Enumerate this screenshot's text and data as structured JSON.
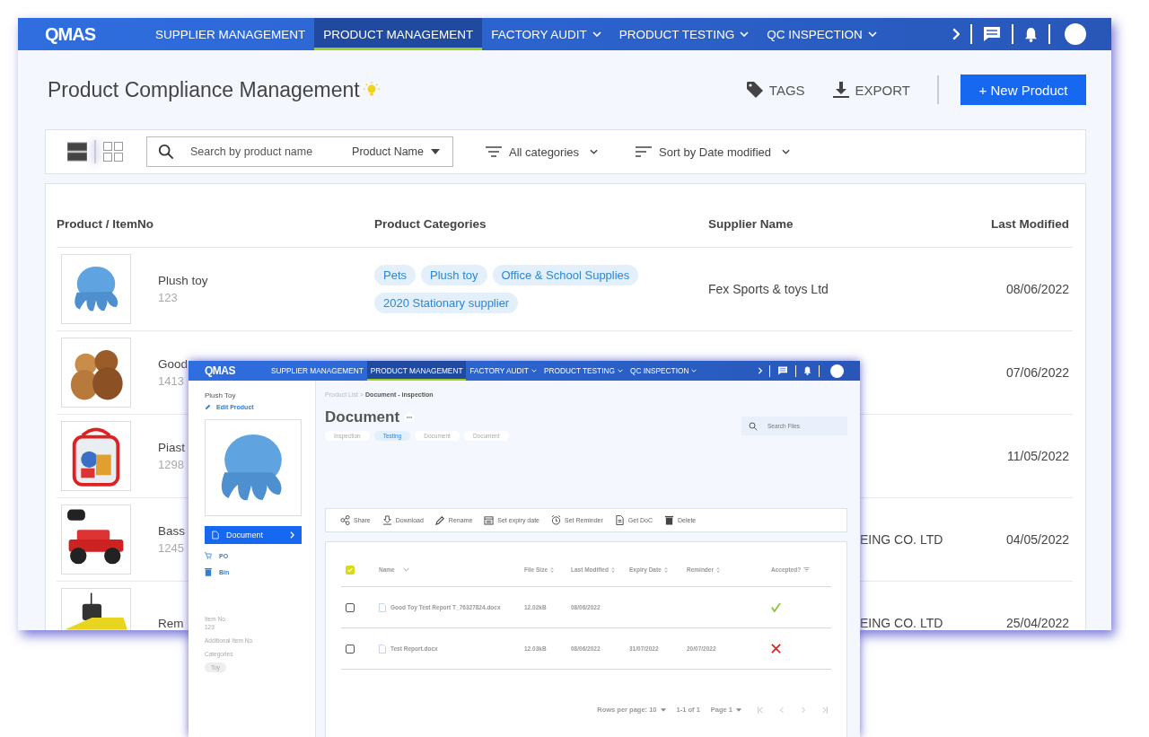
{
  "main_window": {
    "nav": {
      "logo": "QMAS",
      "items": [
        {
          "label": "SUPPLIER MANAGEMENT",
          "selected": false,
          "dropdown": false
        },
        {
          "label": "PRODUCT MANAGEMENT",
          "selected": true,
          "dropdown": false
        },
        {
          "label": "FACTORY AUDIT",
          "selected": false,
          "dropdown": true
        },
        {
          "label": "PRODUCT TESTING",
          "selected": false,
          "dropdown": true
        },
        {
          "label": "QC INSPECTION",
          "selected": false,
          "dropdown": true
        }
      ]
    },
    "title": "Product Compliance Management",
    "actions": [
      {
        "label": "TAGS",
        "kind": "tags"
      },
      {
        "label": "EXPORT",
        "kind": "export"
      }
    ],
    "new_button": "+ New Product",
    "view_modes": [
      {
        "kind": "list",
        "selected": true
      },
      {
        "kind": "grid",
        "selected": false
      }
    ],
    "toolbar": {
      "search_placeholder": "Search by product name",
      "search_field": "Product Name",
      "category_filter": "All categories",
      "sort": "Sort by Date modified"
    },
    "table": {
      "columns": [
        "Product / ItemNo",
        "Product Categories",
        "Supplier Name",
        "Last Modified"
      ],
      "rows": [
        {
          "name": "Plush toy",
          "item_no": "123",
          "categories": [
            "Pets",
            "Plush toy",
            "Office & School Supplies",
            "2020 Stationary supplier"
          ],
          "supplier": "Fex Sports & toys Ltd",
          "modified": "08/06/2022"
        },
        {
          "name": "Good",
          "item_no": "1413",
          "categories": [],
          "modified": "07/06/2022"
        },
        {
          "name": "Piast",
          "item_no": "1298",
          "categories": [],
          "modified": "11/05/2022"
        },
        {
          "name": "Bass",
          "item_no": "1245",
          "categories": [],
          "supplier": "EING CO. LTD",
          "modified": "04/05/2022"
        },
        {
          "name": "Rem",
          "categories": [],
          "supplier": "EING CO. LTD",
          "modified": "25/04/2022"
        }
      ]
    }
  },
  "detail_window": {
    "nav": {
      "logo": "QMAS",
      "items": [
        {
          "label": "SUPPLIER MANAGEMENT",
          "selected": false,
          "dropdown": false
        },
        {
          "label": "PRODUCT MANAGEMENT",
          "selected": true,
          "dropdown": false
        },
        {
          "label": "FACTORY AUDIT",
          "selected": false,
          "dropdown": true
        },
        {
          "label": "PRODUCT TESTING",
          "selected": false,
          "dropdown": true
        },
        {
          "label": "QC INSPECTION",
          "selected": false,
          "dropdown": true
        }
      ]
    },
    "product_name": "Plush Toy",
    "edit_link": "Edit Product",
    "side_nav": [
      {
        "label": "Document",
        "kind": "document",
        "selected": true
      },
      {
        "label": "PO",
        "kind": "cart",
        "selected": false
      },
      {
        "label": "Bin",
        "kind": "bin",
        "selected": false
      }
    ],
    "info": [
      {
        "label": "Item No.",
        "value": "123"
      },
      {
        "label": "Additional Item No."
      },
      {
        "label": "Categories"
      }
    ],
    "category_tags": [
      "Toy"
    ],
    "breadcrumb": {
      "parent": "Product List",
      "separator": ">",
      "current": "Document - inspection"
    },
    "heading": "Document",
    "chips": [
      {
        "label": "Inspection",
        "selected": false
      },
      {
        "label": "Testing",
        "selected": true
      },
      {
        "label": "Document",
        "selected": false
      },
      {
        "label": "Document",
        "selected": false
      }
    ],
    "search_placeholder": "Search Files",
    "actions": [
      {
        "label": "Share",
        "kind": "share"
      },
      {
        "label": "Download",
        "kind": "download"
      },
      {
        "label": "Rename",
        "kind": "rename"
      },
      {
        "label": "Set expiry date",
        "kind": "calendar"
      },
      {
        "label": "Set Reminder",
        "kind": "alarm"
      },
      {
        "label": "Get DoC",
        "kind": "doc"
      },
      {
        "label": "Delete",
        "kind": "delete"
      }
    ],
    "select_all": {
      "checked": true
    },
    "columns": [
      "Name",
      "File Size",
      "Last Modified",
      "Expiry Date",
      "Reminder",
      "Accepted?"
    ],
    "files": [
      {
        "checked": false,
        "name": "Good Toy Test Report T_76327824.docx",
        "size": "12.02kB",
        "modified": "08/06/2022",
        "accepted": true
      },
      {
        "checked": false,
        "name": "Test Report.docx",
        "size": "12.03kB",
        "modified": "08/06/2022",
        "expiry": "31/07/2022",
        "reminder": "20/07/2022",
        "accepted": false
      }
    ],
    "pagination": {
      "rows_per_page": "Rows per page: 10",
      "range": "1-1 of 1",
      "page": "Page 1"
    }
  }
}
